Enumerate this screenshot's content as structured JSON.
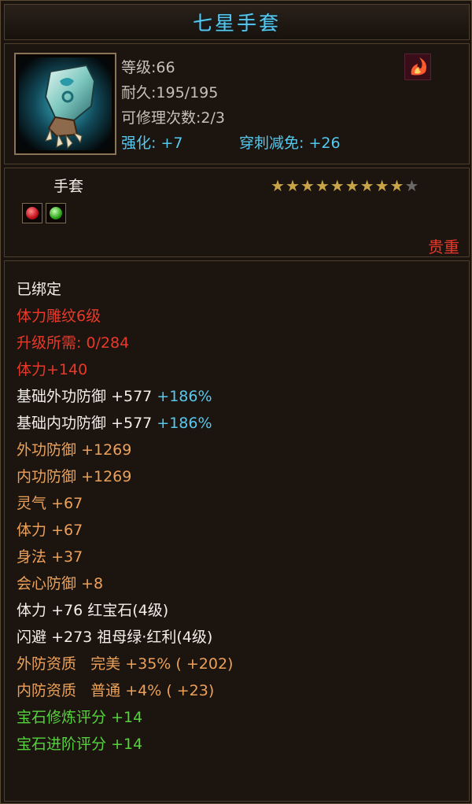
{
  "title": "七星手套",
  "header": {
    "level_label": "等级:",
    "level": "66",
    "durability_label": "耐久:",
    "durability": "195/195",
    "repair_label": "可修理次数:",
    "repair": "2/3",
    "enhance_label": "强化:",
    "enhance": "+7",
    "pierce_label": "穿刺减免:",
    "pierce": "+26"
  },
  "type_label": "手套",
  "rarity": "贵重",
  "stars": {
    "filled": 9,
    "total": 10
  },
  "gems": [
    "red",
    "green"
  ],
  "bound": "已绑定",
  "engrave": "体力雕纹6级",
  "upgrade": "升级所需: 0/284",
  "engrave_bonus": "体力+140",
  "base_stats": [
    {
      "name": "基础外功防御",
      "value": "+577",
      "pct": "+186%"
    },
    {
      "name": "基础内功防御",
      "value": "+577",
      "pct": "+186%"
    }
  ],
  "def_stats": [
    {
      "name": "外功防御",
      "value": "+1269"
    },
    {
      "name": "内功防御",
      "value": "+1269"
    }
  ],
  "bonus_stats": [
    {
      "name": "灵气",
      "value": "+67"
    },
    {
      "name": "体力",
      "value": "+67"
    },
    {
      "name": "身法",
      "value": "+37"
    },
    {
      "name": "会心防御",
      "value": "+8"
    }
  ],
  "gem_stats": [
    {
      "name": "体力",
      "value": "+76",
      "gem": "红宝石(4级)"
    },
    {
      "name": "闪避",
      "value": "+273",
      "gem": "祖母绿·红利(4级)"
    }
  ],
  "qualities": [
    {
      "name": "外防资质",
      "grade": "完美",
      "pct": "+35%",
      "extra": "( +202)"
    },
    {
      "name": "内防资质",
      "grade": "普通",
      "pct": "+4%",
      "extra": "( +23)"
    }
  ],
  "scores": [
    {
      "name": "宝石修炼评分",
      "value": "+14"
    },
    {
      "name": "宝石进阶评分",
      "value": "+14"
    }
  ],
  "colors": {
    "title": "#57c9ee",
    "cyan": "#57c9ee",
    "red": "#e8392b",
    "orange": "#eba15a",
    "green": "#55d33c",
    "star": "#c9a548",
    "background": "#1b130e"
  },
  "icons": {
    "item": "gauntlet-icon",
    "skill": "flame-skill-icon",
    "gems": [
      "ruby-gem-icon",
      "emerald-gem-icon"
    ]
  }
}
